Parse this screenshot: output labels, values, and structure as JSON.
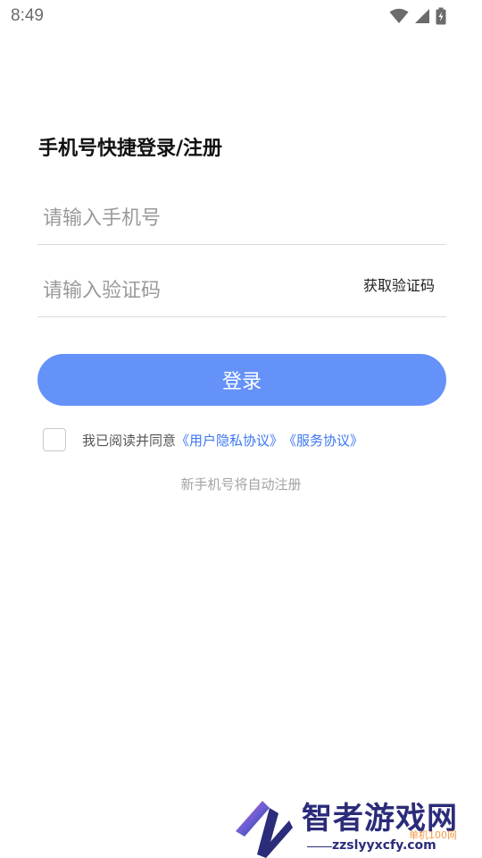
{
  "status_bar": {
    "time": "8:49",
    "icons": [
      "wifi-icon",
      "cell-signal-icon",
      "battery-charging-icon"
    ]
  },
  "login": {
    "title": "手机号快捷登录/注册",
    "phone_placeholder": "请输入手机号",
    "code_placeholder": "请输入验证码",
    "get_code_label": "获取验证码",
    "submit_label": "登录",
    "agree_prefix": "我已阅读并同意",
    "privacy_link": "《用户隐私协议》",
    "service_link": "《服务协议》",
    "new_user_note": "新手机号将自动注册"
  },
  "colors": {
    "accent": "#6592f9",
    "link": "#3b77f2"
  },
  "watermark": {
    "brand": "智者游戏网",
    "domain": "zzslyyxcfy.com",
    "sub": "单机100网"
  }
}
